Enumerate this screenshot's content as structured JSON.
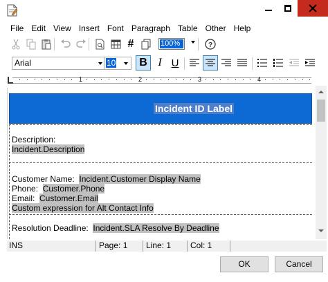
{
  "menu": [
    "File",
    "Edit",
    "View",
    "Insert",
    "Font",
    "Paragraph",
    "Table",
    "Other",
    "Help"
  ],
  "toolbar": {
    "zoom_value": "100%"
  },
  "format_toolbar": {
    "font_name": "Arial",
    "font_size": "10",
    "bold_label": "B",
    "italic_label": "I",
    "underline_label": "U"
  },
  "ruler": {
    "marks": [
      "1",
      "2",
      "3",
      "4"
    ]
  },
  "document": {
    "banner_title": "Incident ID Label",
    "description_label": "Description:",
    "description_field": "Incident.Description",
    "customer_name_label": "Customer Name:",
    "customer_name_field": "Incident.Customer Display Name",
    "phone_label": "Phone:",
    "phone_field": "Customer.Phone",
    "email_label": "Email:",
    "email_field": "Customer.Email",
    "alt_contact_field": "Custom expression for Alt Contact Info",
    "deadline_label": "Resolution Deadline:",
    "deadline_field": "Incident.SLA Resolve By Deadline"
  },
  "status": {
    "mode": "INS",
    "page": "Page: 1",
    "line": "Line: 1",
    "col": "Col: 1"
  },
  "buttons": {
    "ok": "OK",
    "cancel": "Cancel"
  },
  "colors": {
    "banner": "#0d6ad5",
    "field_highlight": "#c0c0c0",
    "close_button": "#c42b1c"
  }
}
